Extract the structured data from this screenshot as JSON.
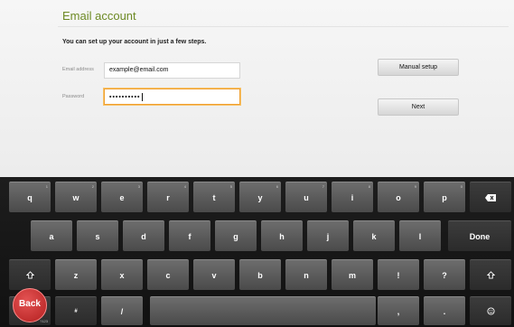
{
  "form": {
    "title": "Email account",
    "subtitle": "You can set up your account in just a few steps.",
    "email_label": "Email address",
    "email_value": "example@email.com",
    "password_label": "Password",
    "password_value": "••••••••••",
    "manual_setup_label": "Manual setup",
    "next_label": "Next"
  },
  "keyboard": {
    "row1": [
      "q",
      "w",
      "e",
      "r",
      "t",
      "y",
      "u",
      "i",
      "o",
      "p"
    ],
    "row1_hints": [
      "1",
      "2",
      "3",
      "4",
      "5",
      "6",
      "7",
      "8",
      "9",
      "0"
    ],
    "row2": [
      "a",
      "s",
      "d",
      "f",
      "g",
      "h",
      "j",
      "k",
      "l"
    ],
    "row3": [
      "z",
      "x",
      "c",
      "v",
      "b",
      "n",
      "m",
      "!",
      "?"
    ],
    "done_label": "Done",
    "comma_label": ",",
    "period_label": ".",
    "slash_label": "/",
    "numeric_sub": "?123",
    "symbols_label": "#"
  },
  "back_overlay": "Back",
  "colors": {
    "title_green": "#6d8a24",
    "focus_orange": "#f0a030",
    "back_red": "#c62828"
  }
}
